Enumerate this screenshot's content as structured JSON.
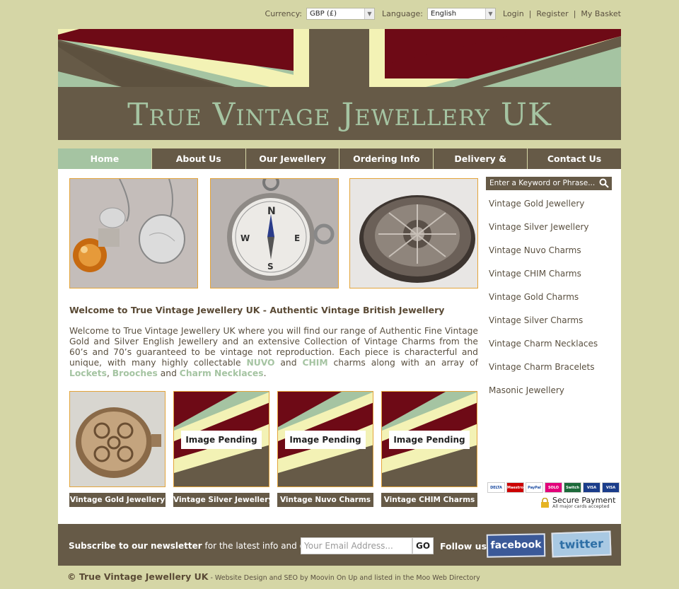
{
  "topbar": {
    "currency_label": "Currency:",
    "currency_value": "GBP (£)",
    "language_label": "Language:",
    "language_value": "English",
    "login": "Login",
    "register": "Register",
    "basket": "My Basket"
  },
  "banner": {
    "title": "True Vintage Jewellery UK"
  },
  "nav": [
    "Home",
    "About Us",
    "Our Jewellery",
    "Ordering Info",
    "Delivery & Returns",
    "Contact Us"
  ],
  "welcome": {
    "heading": "Welcome to True Vintage Jewellery UK - Authentic Vintage British Jewellery",
    "p1": "Welcome to True Vintage Jewellery UK where you will find our range of Authentic Fine Vintage Gold and Silver English Jewellery and an extensive Collection of Vintage Charms from the 60’s and 70’s guaranteed to be vintage not reproduction. Each piece is characterful and unique, with many highly collectable ",
    "nuvo": "NUVO",
    "and1": " and ",
    "chim": "CHIM",
    "p2": " charms along with an array of ",
    "lockets": "Lockets",
    "comma": ", ",
    "brooches": "Brooches",
    "and2": " and ",
    "necklaces": "Charm Necklaces",
    "end": "."
  },
  "products": [
    {
      "caption": "Vintage Gold Jewellery",
      "pending": ""
    },
    {
      "caption": "Vintage Silver Jewellery",
      "pending": "Image Pending"
    },
    {
      "caption": "Vintage Nuvo Charms",
      "pending": "Image Pending"
    },
    {
      "caption": "Vintage CHIM Charms",
      "pending": "Image Pending"
    }
  ],
  "sidebar": {
    "search_placeholder": "Enter a Keyword or Phrase...",
    "links": [
      "Vintage Gold Jewellery",
      "Vintage Silver Jewellery",
      "Vintage Nuvo Charms",
      "Vintage CHIM Charms",
      "Vintage Gold Charms",
      "Vintage Silver Charms",
      "Vintage Charm Necklaces",
      "Vintage Charm Bracelets",
      "Masonic Jewellery"
    ],
    "cards": [
      "DELTA",
      "Maestro",
      "PayPal",
      "SOLO",
      "Switch",
      "VISA",
      "VISA Electron"
    ],
    "secure": "Secure Payment",
    "secure_small": "All major cards accepted"
  },
  "newsletter": {
    "bold": "Subscribe to our newsletter",
    "rest": " for the latest info and offers",
    "email_placeholder": "Your Email Address...",
    "go": "GO",
    "follow": "Follow us",
    "facebook": "facebook",
    "twitter": "twitter"
  },
  "footer": {
    "bold": "© True Vintage Jewellery UK",
    "rest": " - Website Design and SEO by Moovin On Up and listed in the Moo Web Directory"
  },
  "colors": {
    "brown": "#665a47",
    "green": "#a5c4a2",
    "bg": "#d5d6a6",
    "maroon": "#6e0a16",
    "cream": "#f3f2b5"
  }
}
